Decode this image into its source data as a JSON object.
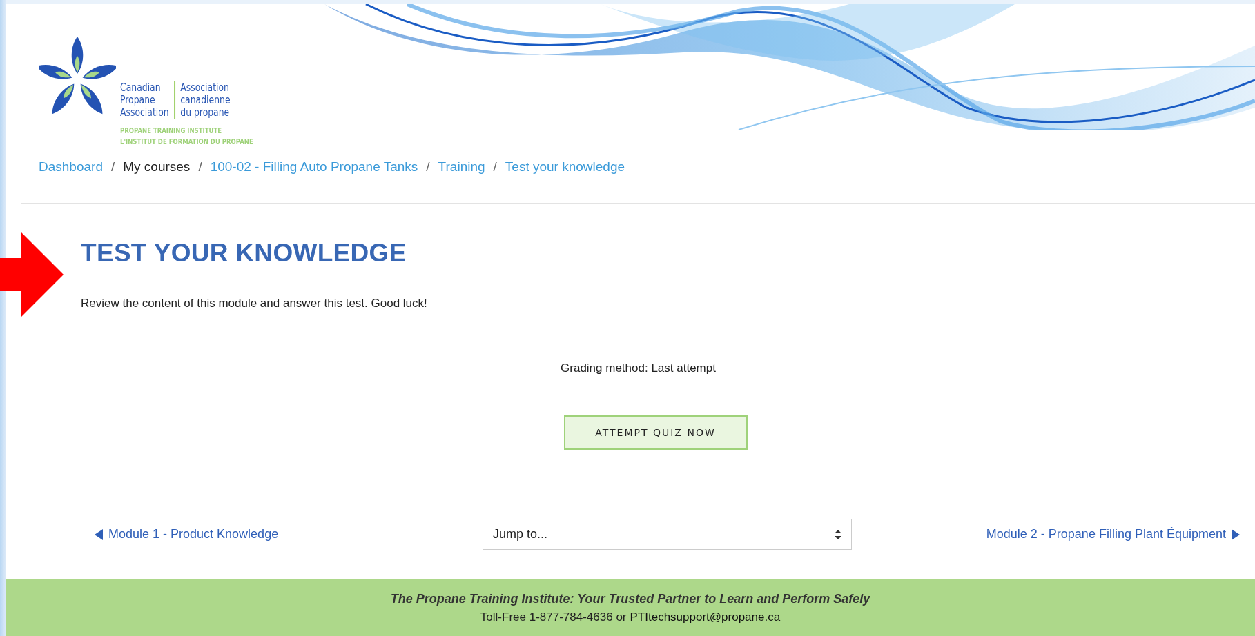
{
  "logo": {
    "english": [
      "Canadian",
      "Propane",
      "Association"
    ],
    "french": [
      "Association",
      "canadienne",
      "du propane"
    ],
    "institute": [
      "PROPANE TRAINING INSTITUTE",
      "L'INSTITUT DE FORMATION DU PROPANE"
    ]
  },
  "breadcrumb_separator": "/",
  "breadcrumb": [
    {
      "label": "Dashboard",
      "link": true
    },
    {
      "label": "My courses",
      "link": false
    },
    {
      "label": "100-02 - Filling Auto Propane Tanks",
      "link": true
    },
    {
      "label": "Training",
      "link": true
    },
    {
      "label": "Test your knowledge",
      "link": true
    }
  ],
  "page": {
    "title": "TEST YOUR KNOWLEDGE",
    "description": "Review the content of this module and answer this test. Good luck!",
    "grading": "Grading method: Last attempt",
    "button": "ATTEMPT QUIZ NOW"
  },
  "navigation": {
    "previous": "Module 1 - Product Knowledge",
    "jump_select": {
      "value": "Jump to..."
    },
    "next": "Module 2 - Propane Filling Plant Équipment"
  },
  "footer": {
    "tagline": "The Propane Training Institute: Your Trusted Partner to Learn and Perform Safely",
    "contact": "Toll-Free 1-877-784-4636 or",
    "email": "PTItechsupport@propane.ca"
  }
}
